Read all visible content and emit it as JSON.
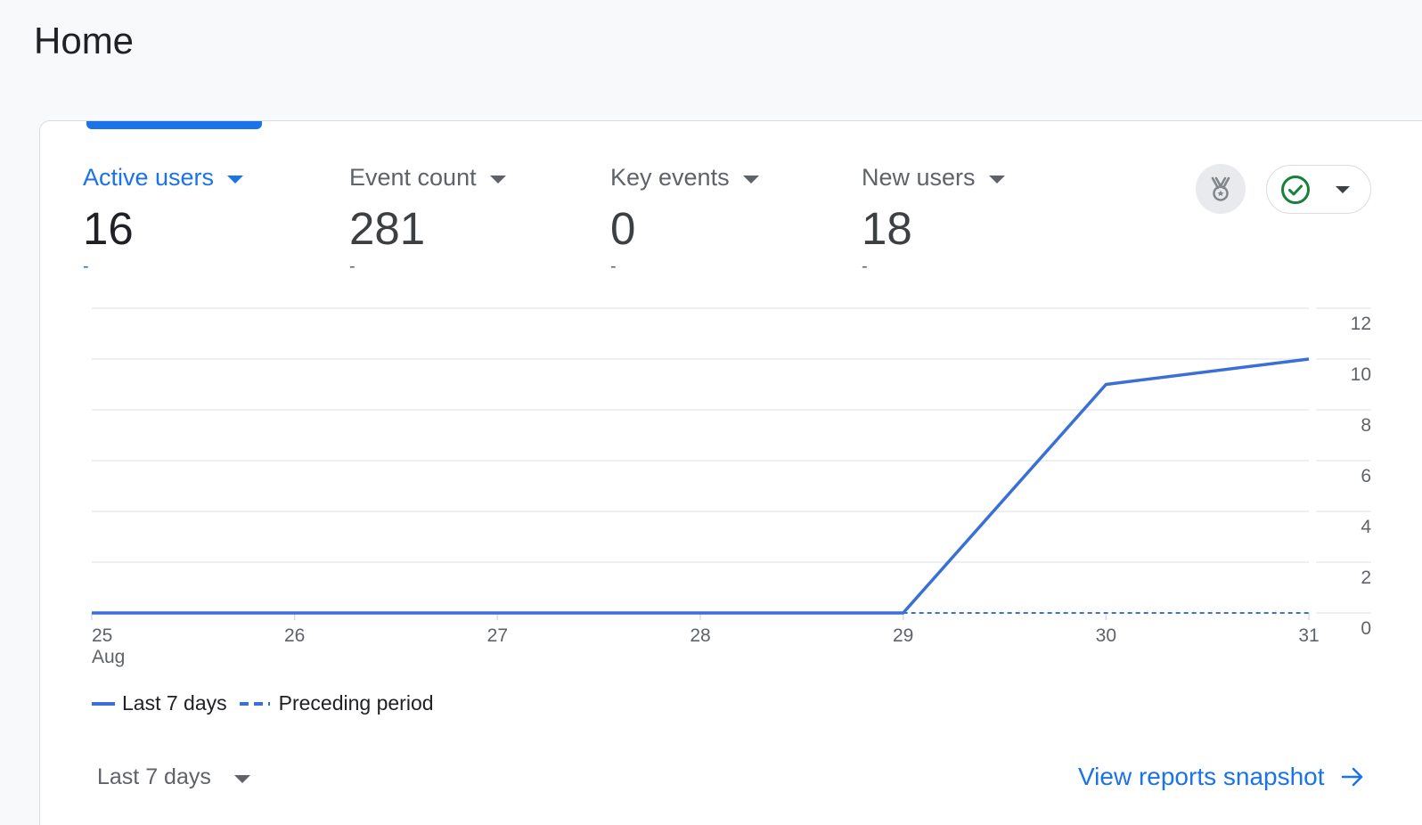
{
  "page": {
    "title": "Home"
  },
  "metrics": [
    {
      "label": "Active users",
      "value": "16",
      "change": "-",
      "active": true
    },
    {
      "label": "Event count",
      "value": "281",
      "change": "-",
      "active": false
    },
    {
      "label": "Key events",
      "value": "0",
      "change": "-",
      "active": false
    },
    {
      "label": "New users",
      "value": "18",
      "change": "-",
      "active": false
    }
  ],
  "toolbar": {
    "insights_icon": "medal-icon",
    "status_icon": "check-circle-icon",
    "status_color": "#188038"
  },
  "chart_data": {
    "type": "line",
    "x": [
      "25",
      "26",
      "27",
      "28",
      "29",
      "30",
      "31"
    ],
    "x_month_label": "Aug",
    "series": [
      {
        "name": "Last 7 days",
        "style": "solid",
        "values": [
          0,
          0,
          0,
          0,
          0,
          9,
          10
        ]
      },
      {
        "name": "Preceding period",
        "style": "dashed",
        "values": [
          null,
          null,
          null,
          null,
          0,
          0,
          0
        ]
      }
    ],
    "y_ticks": [
      0,
      2,
      4,
      6,
      8,
      10,
      12
    ],
    "ylim": [
      0,
      12
    ],
    "y_axis_side": "right",
    "grid": true,
    "legend_position": "bottom-left",
    "line_color": "#3a6fd8"
  },
  "footer": {
    "date_range_label": "Last 7 days",
    "view_link_label": "View reports snapshot"
  }
}
